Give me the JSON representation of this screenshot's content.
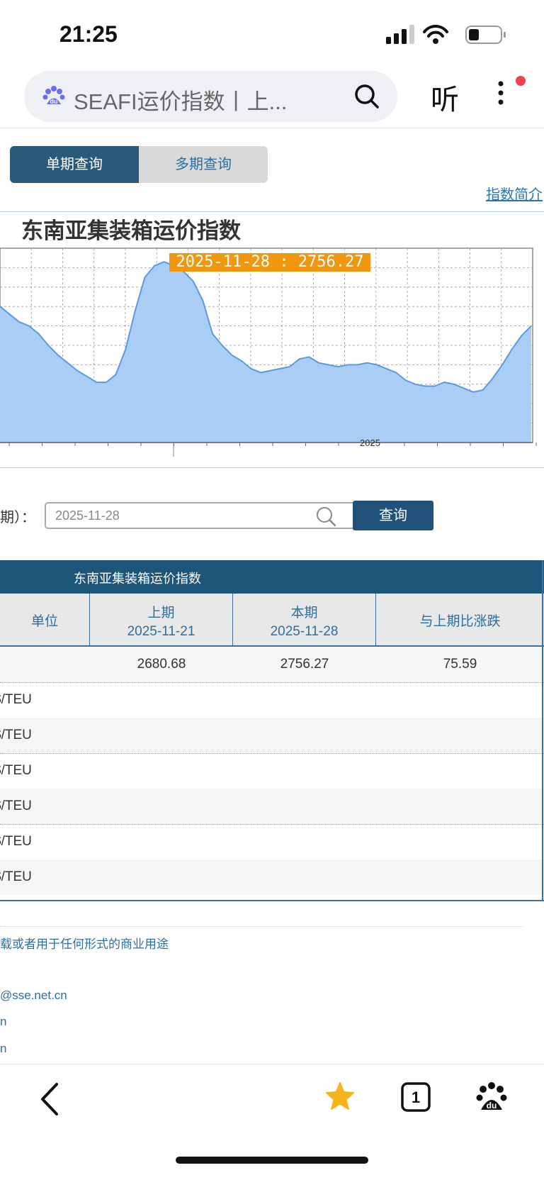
{
  "status": {
    "time": "21:25"
  },
  "browser": {
    "search_text": "SEAFI运价指数丨上...",
    "listen_label": "听"
  },
  "tabs": {
    "single": "单期查询",
    "multi": "多期查询"
  },
  "index_link": "指数简介",
  "chart": {
    "title": "东南亚集装箱运价指数",
    "tooltip": "2025-11-28 : 2756.27",
    "year_tick": "2025",
    "fill_color": "#a9cdf4",
    "line_color": "#5b9ae0"
  },
  "chart_data": {
    "type": "area",
    "title": "东南亚集装箱运价指数",
    "x_tick_labels": [
      "2025"
    ],
    "highlight": {
      "date": "2025-11-28",
      "value": 2756.27
    },
    "series": [
      {
        "values": [
          0.7,
          0.66,
          0.62,
          0.6,
          0.56,
          0.5,
          0.45,
          0.41,
          0.37,
          0.34,
          0.31,
          0.31,
          0.35,
          0.48,
          0.68,
          0.85,
          0.91,
          0.93,
          0.91,
          0.88,
          0.83,
          0.73,
          0.56,
          0.5,
          0.45,
          0.42,
          0.38,
          0.36,
          0.37,
          0.38,
          0.39,
          0.43,
          0.44,
          0.41,
          0.4,
          0.39,
          0.4,
          0.4,
          0.41,
          0.4,
          0.38,
          0.36,
          0.32,
          0.3,
          0.29,
          0.29,
          0.31,
          0.3,
          0.28,
          0.26,
          0.27,
          0.33,
          0.4,
          0.48,
          0.55,
          0.6
        ]
      }
    ],
    "grid": true
  },
  "query": {
    "label": "期）：",
    "date_value": "2025-11-28",
    "button": "查询"
  },
  "table": {
    "title": "东南亚集装箱运价指数",
    "headers": {
      "unit": "单位",
      "prev_label": "上期",
      "prev_date": "2025-11-21",
      "cur_label": "本期",
      "cur_date": "2025-11-28",
      "change": "与上期比涨跌"
    },
    "rows": [
      {
        "unit": "",
        "prev": "2680.68",
        "cur": "2756.27",
        "change": "75.59"
      },
      {
        "unit": "$/TEU",
        "prev": "",
        "cur": "",
        "change": ""
      },
      {
        "unit": "$/TEU",
        "prev": "",
        "cur": "",
        "change": ""
      },
      {
        "unit": "$/TEU",
        "prev": "",
        "cur": "",
        "change": ""
      },
      {
        "unit": "$/TEU",
        "prev": "",
        "cur": "",
        "change": ""
      },
      {
        "unit": "$/TEU",
        "prev": "",
        "cur": "",
        "change": ""
      },
      {
        "unit": "$/TEU",
        "prev": "",
        "cur": "",
        "change": ""
      }
    ]
  },
  "footer": {
    "notice": "载或者用于任何形式的商业用途",
    "email": "@sse.net.cn",
    "line2": "n",
    "line3": "n"
  }
}
